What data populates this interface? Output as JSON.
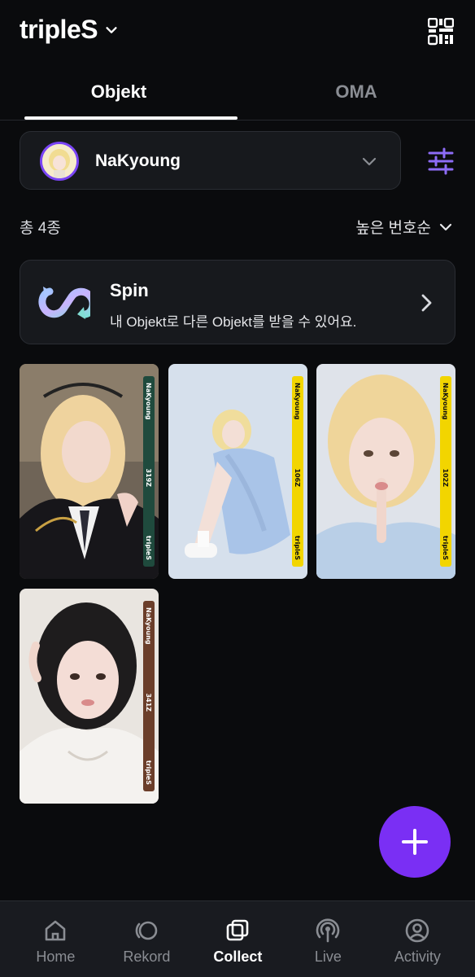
{
  "header": {
    "title": "tripleS",
    "chevron_icon": "chevron-down-icon",
    "qr_icon": "qr-code-icon"
  },
  "tabs": [
    {
      "label": "Objekt",
      "active": true
    },
    {
      "label": "OMA",
      "active": false
    }
  ],
  "member_select": {
    "name": "NaKyoung",
    "avatar_icon": "member-avatar",
    "chevron_icon": "chevron-down-icon"
  },
  "filter": {
    "icon": "sliders-icon"
  },
  "list_summary": {
    "total": "총 4종",
    "sort_label": "높은 번호순"
  },
  "spin": {
    "title": "Spin",
    "description": "내 Objekt로 다른 Objekt를 받을 수 있어요.",
    "arrow_icon": "chevron-right-icon"
  },
  "objekts": [
    {
      "member": "NaKyoung",
      "number": "319Z",
      "group": "tripleS",
      "strip_color": "#1f4a3d",
      "text_color": "#ffffff"
    },
    {
      "member": "NaKyoung",
      "number": "106Z",
      "group": "tripleS",
      "strip_color": "#f2d500",
      "text_color": "#111111"
    },
    {
      "member": "NaKyoung",
      "number": "102Z",
      "group": "tripleS",
      "strip_color": "#f2d500",
      "text_color": "#111111"
    },
    {
      "member": "NaKyoung",
      "number": "341Z",
      "group": "tripleS",
      "strip_color": "#6b3e2a",
      "text_color": "#ffffff"
    }
  ],
  "fab": {
    "icon": "plus-icon"
  },
  "bottom_nav": [
    {
      "label": "Home",
      "icon": "home-icon",
      "active": false
    },
    {
      "label": "Rekord",
      "icon": "rekord-icon",
      "active": false
    },
    {
      "label": "Collect",
      "icon": "collect-icon",
      "active": true
    },
    {
      "label": "Live",
      "icon": "live-icon",
      "active": false
    },
    {
      "label": "Activity",
      "icon": "activity-icon",
      "active": false
    }
  ],
  "colors": {
    "background": "#0a0b0d",
    "accent": "#7a2ff4",
    "card": "#17191d"
  }
}
